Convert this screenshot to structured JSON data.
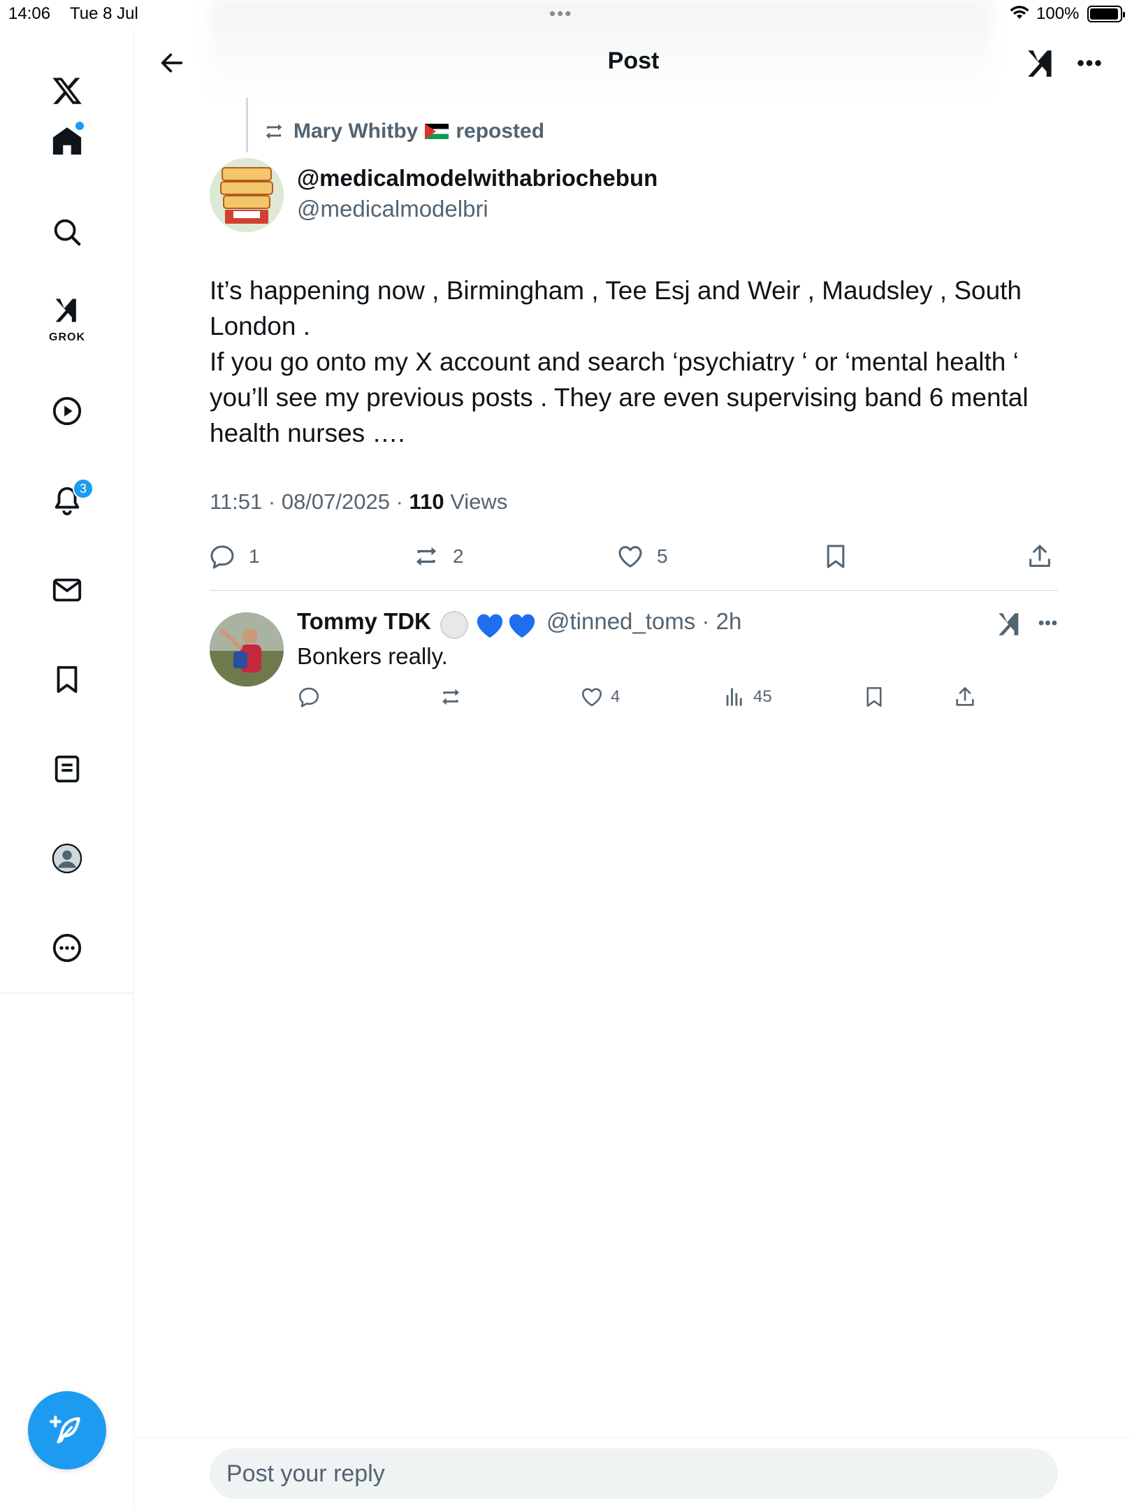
{
  "status_bar": {
    "time": "14:06",
    "date": "Tue 8 Jul",
    "battery": "100%"
  },
  "sidebar": {
    "items": [
      {
        "name": "home",
        "icon": "home-icon"
      },
      {
        "name": "explore",
        "icon": "search-icon"
      },
      {
        "name": "grok",
        "icon": "grok-icon",
        "label": "GROK"
      },
      {
        "name": "video",
        "icon": "play-icon"
      },
      {
        "name": "notifications",
        "icon": "bell-icon",
        "badge": "3"
      },
      {
        "name": "messages",
        "icon": "mail-icon"
      },
      {
        "name": "bookmarks",
        "icon": "bookmark-icon"
      },
      {
        "name": "lists",
        "icon": "list-icon"
      },
      {
        "name": "profile",
        "icon": "profile-icon"
      },
      {
        "name": "more",
        "icon": "more-circle-icon"
      }
    ],
    "accent": "#1d9bf0"
  },
  "header": {
    "title": "Post"
  },
  "post": {
    "reposted_by": "Mary Whitby",
    "reposted_label": "reposted",
    "author_name": "@medicalmodelwithabriochebun",
    "author_handle": "@medicalmodelbri",
    "text_lines": [
      "It’s happening now , Birmingham , Tee Esj and Weir , Maudsley , South London .",
      "If you go onto my X account and search ‘psychiatry ‘ or ‘mental health ‘ you’ll see my previous posts . They are even supervising band 6 mental health nurses …."
    ],
    "time": "11:51 · 08/07/2025 ·",
    "views_count": "110",
    "views_label": "Views",
    "replies": "1",
    "reposts": "2",
    "likes": "5"
  },
  "reply": {
    "name": "Tommy TDK",
    "handle": "@tinned_toms · 2h",
    "text": "Bonkers really.",
    "likes": "4",
    "views": "45"
  },
  "compose": {
    "placeholder": "Post your reply"
  }
}
